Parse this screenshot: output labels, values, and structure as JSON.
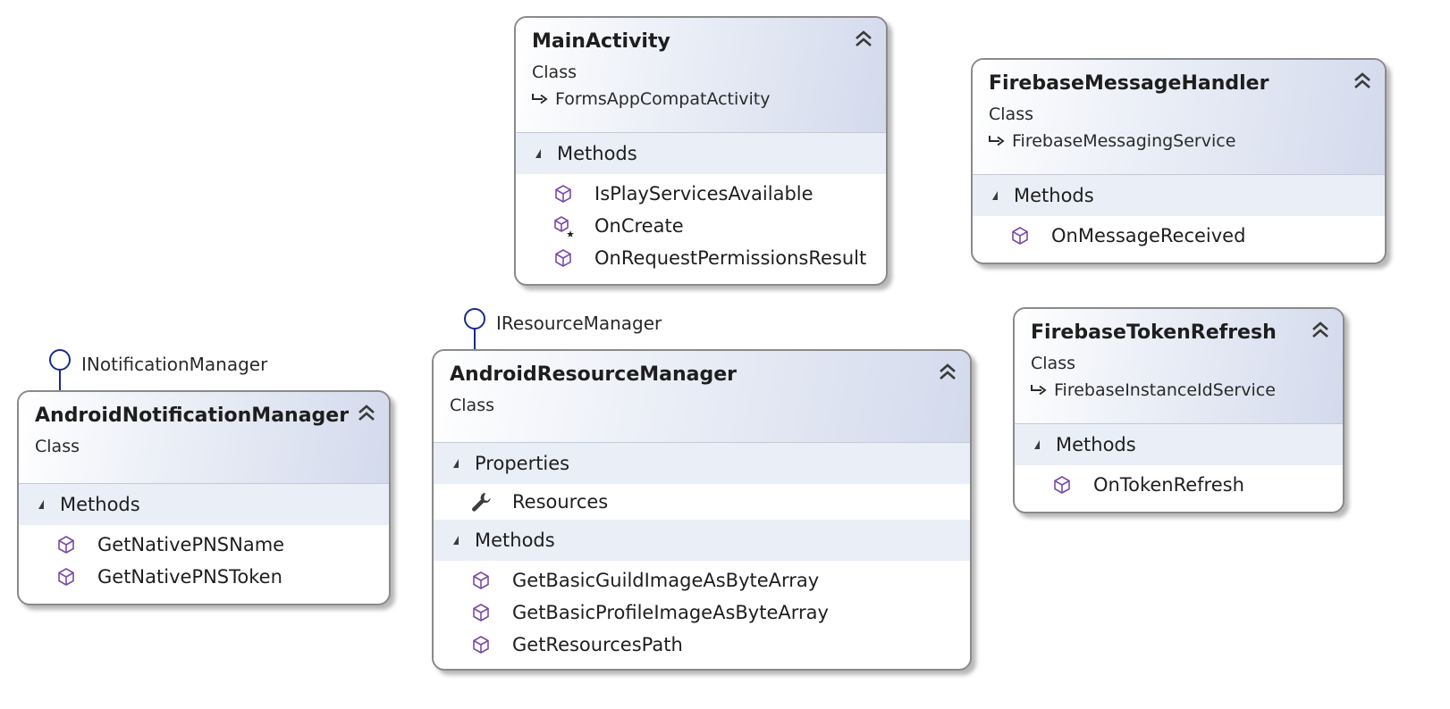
{
  "classes": {
    "main_activity": {
      "name": "MainActivity",
      "kind": "Class",
      "base": "FormsAppCompatActivity",
      "sections": [
        {
          "title": "Methods",
          "members": [
            "IsPlayServicesAvailable",
            "OnCreate",
            "OnRequestPermissionsResult"
          ]
        }
      ]
    },
    "firebase_message_handler": {
      "name": "FirebaseMessageHandler",
      "kind": "Class",
      "base": "FirebaseMessagingService",
      "sections": [
        {
          "title": "Methods",
          "members": [
            "OnMessageReceived"
          ]
        }
      ]
    },
    "android_notification_manager": {
      "name": "AndroidNotificationManager",
      "kind": "Class",
      "interface": "INotificationManager",
      "sections": [
        {
          "title": "Methods",
          "members": [
            "GetNativePNSName",
            "GetNativePNSToken"
          ]
        }
      ]
    },
    "android_resource_manager": {
      "name": "AndroidResourceManager",
      "kind": "Class",
      "interface": "IResourceManager",
      "sections": [
        {
          "title": "Properties",
          "members": [
            "Resources"
          ]
        },
        {
          "title": "Methods",
          "members": [
            "GetBasicGuildImageAsByteArray",
            "GetBasicProfileImageAsByteArray",
            "GetResourcesPath"
          ]
        }
      ]
    },
    "firebase_token_refresh": {
      "name": "FirebaseTokenRefresh",
      "kind": "Class",
      "base": "FirebaseInstanceIdService",
      "sections": [
        {
          "title": "Methods",
          "members": [
            "OnTokenRefresh"
          ]
        }
      ]
    }
  },
  "icons": {
    "method": "method-cube-icon",
    "override_method": "override-method-icon",
    "property": "wrench-icon",
    "inherit": "inheritance-arrow-icon",
    "collapse": "double-chevron-up-icon",
    "interface": "interface-lollipop-icon"
  },
  "colors": {
    "header_gradient_end": "#d3daec",
    "section_band": "#eaeef7",
    "border": "#8a8a8a",
    "method_icon": "#7a4aa8",
    "interface_line": "#1a2a8a"
  }
}
